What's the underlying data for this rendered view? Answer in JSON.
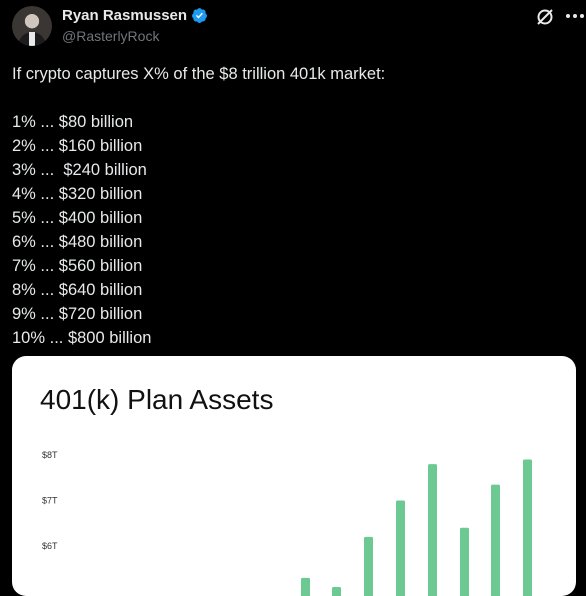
{
  "author": {
    "name": "Ryan Rasmussen",
    "handle": "@RasterlyRock"
  },
  "tweet": {
    "lines": [
      "If crypto captures X% of the $8 trillion 401k market:",
      "",
      "1% ... $80 billion",
      "2% ... $160 billion",
      "3% ...  $240 billion",
      "4% ... $320 billion",
      "5% ... $400 billion",
      "6% ... $480 billion",
      "7% ... $560 billion",
      "8% ... $640 billion",
      "9% ... $720 billion",
      "10% ... $800 billion"
    ]
  },
  "icons": {
    "verified": "verified-badge-icon",
    "grok": "grok-icon",
    "more": "more-icon"
  },
  "colors": {
    "bar": "#6cc991",
    "verified": "#1d9bf0"
  },
  "chart_data": {
    "type": "bar",
    "title": "401(k) Plan Assets",
    "ytick_labels": [
      "$8T",
      "$7T",
      "$6T"
    ],
    "yticks": [
      8,
      7,
      6
    ],
    "values": [
      5.3,
      5.1,
      6.2,
      7.0,
      7.8,
      6.4,
      7.35,
      7.9
    ],
    "units": "trillion USD"
  }
}
